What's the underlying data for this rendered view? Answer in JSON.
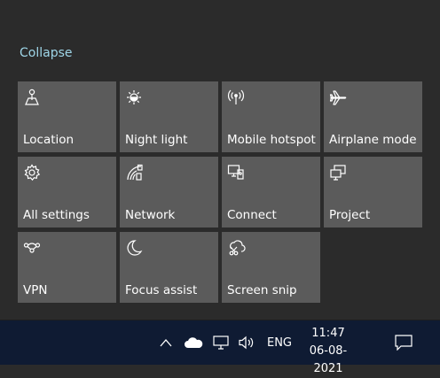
{
  "action_center": {
    "collapse_label": "Collapse",
    "tiles": [
      {
        "label": "Location",
        "icon": "location-icon"
      },
      {
        "label": "Night light",
        "icon": "night-light-icon"
      },
      {
        "label": "Mobile hotspot",
        "icon": "mobile-hotspot-icon"
      },
      {
        "label": "Airplane mode",
        "icon": "airplane-icon"
      },
      {
        "label": "All settings",
        "icon": "gear-icon"
      },
      {
        "label": "Network",
        "icon": "network-icon"
      },
      {
        "label": "Connect",
        "icon": "connect-icon"
      },
      {
        "label": "Project",
        "icon": "project-icon"
      },
      {
        "label": "VPN",
        "icon": "vpn-icon"
      },
      {
        "label": "Focus assist",
        "icon": "moon-icon"
      },
      {
        "label": "Screen snip",
        "icon": "screen-snip-icon"
      }
    ],
    "colors": {
      "tile": "#5b5b5b",
      "background": "#2b2b2b",
      "accent_link": "#9fd6e8"
    }
  },
  "taskbar": {
    "language": "ENG",
    "time": "11:47",
    "date": "06-08-2021",
    "icons": [
      "chevron-up-icon",
      "onedrive-cloud-icon",
      "network-monitor-icon",
      "volume-icon",
      "notification-icon"
    ],
    "color": "#0f1b33"
  }
}
